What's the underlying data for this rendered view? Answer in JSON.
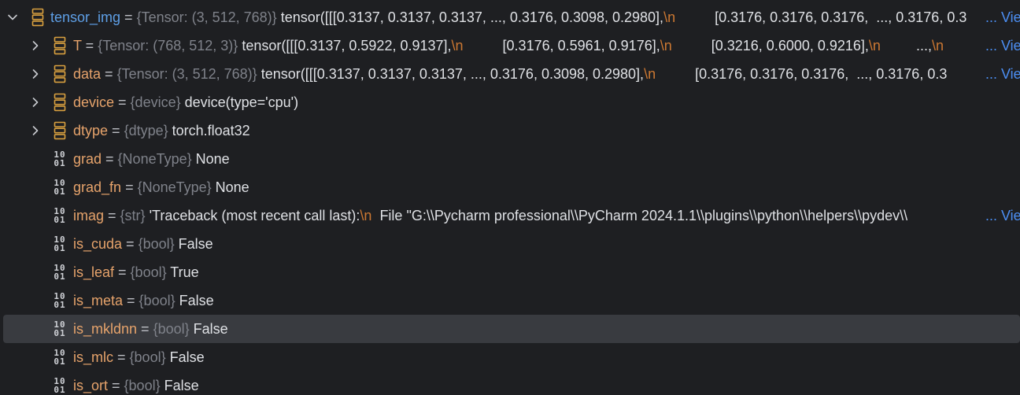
{
  "root": {
    "name": "tensor_img",
    "eq": " = ",
    "type": "{Tensor: (3, 512, 768)}",
    "value_a": " tensor([[[0.3137, 0.3137, 0.3137,  ..., 0.3176, 0.3098, 0.2980],",
    "nl": "\\n",
    "value_b": "          [0.3176, 0.3176, 0.3176,  ..., 0.3176, 0.3",
    "view": "... View"
  },
  "rows": [
    {
      "name": "T",
      "eq": " = ",
      "type": "{Tensor: (768, 512, 3)}",
      "value_a": " tensor([[[0.3137, 0.5922, 0.9137],",
      "nl1": "\\n",
      "value_b": "          [0.3176, 0.5961, 0.9176],",
      "nl2": "\\n",
      "value_c": "          [0.3216, 0.6000, 0.9216],",
      "nl3": "\\n",
      "value_d": "         ...,",
      "nl4": "\\n",
      "view": "... View"
    },
    {
      "name": "data",
      "eq": " = ",
      "type": "{Tensor: (3, 512, 768)}",
      "value_a": " tensor([[[0.3137, 0.3137, 0.3137,  ..., 0.3176, 0.3098, 0.2980],",
      "nl": "\\n",
      "value_b": "          [0.3176, 0.3176, 0.3176,  ..., 0.3176, 0.3",
      "view": "... View"
    },
    {
      "name": "device",
      "eq": " = ",
      "type": "{device}",
      "value": " device(type='cpu')"
    },
    {
      "name": "dtype",
      "eq": " = ",
      "type": "{dtype}",
      "value": " torch.float32"
    },
    {
      "name": "grad",
      "eq": " = ",
      "type": "{NoneType}",
      "value": " None"
    },
    {
      "name": "grad_fn",
      "eq": " = ",
      "type": "{NoneType}",
      "value": " None"
    },
    {
      "name": "imag",
      "eq": " = ",
      "type": "{str}",
      "value_a": " 'Traceback (most recent call last):",
      "nl": "\\n",
      "value_b": "  File \"G:\\\\Pycharm professional\\\\PyCharm 2024.1.1\\\\plugins\\\\python\\\\helpers\\\\pydev\\\\",
      "view": "... View"
    },
    {
      "name": "is_cuda",
      "eq": " = ",
      "type": "{bool}",
      "value": " False"
    },
    {
      "name": "is_leaf",
      "eq": " = ",
      "type": "{bool}",
      "value": " True"
    },
    {
      "name": "is_meta",
      "eq": " = ",
      "type": "{bool}",
      "value": " False"
    },
    {
      "name": "is_mkldnn",
      "eq": " = ",
      "type": "{bool}",
      "value": " False"
    },
    {
      "name": "is_mlc",
      "eq": " = ",
      "type": "{bool}",
      "value": " False"
    },
    {
      "name": "is_ort",
      "eq": " = ",
      "type": "{bool}",
      "value": " False"
    }
  ],
  "icons": {
    "object": "object-field-icon",
    "primitive": "primitive-field-icon",
    "primitive_glyph_top": "10",
    "primitive_glyph_bottom": "01",
    "expand": "chevron-right-icon",
    "collapse": "chevron-down-icon"
  },
  "colors": {
    "background": "#1e1f22",
    "selection": "#393b40",
    "field_name": "#e6a36b",
    "root_name": "#5e9fe6",
    "type_hint": "#7f828a",
    "escape": "#cc7832",
    "link": "#4c8ef2",
    "object_icon": "#d9a03f"
  },
  "selected_row": "is_mkldnn"
}
